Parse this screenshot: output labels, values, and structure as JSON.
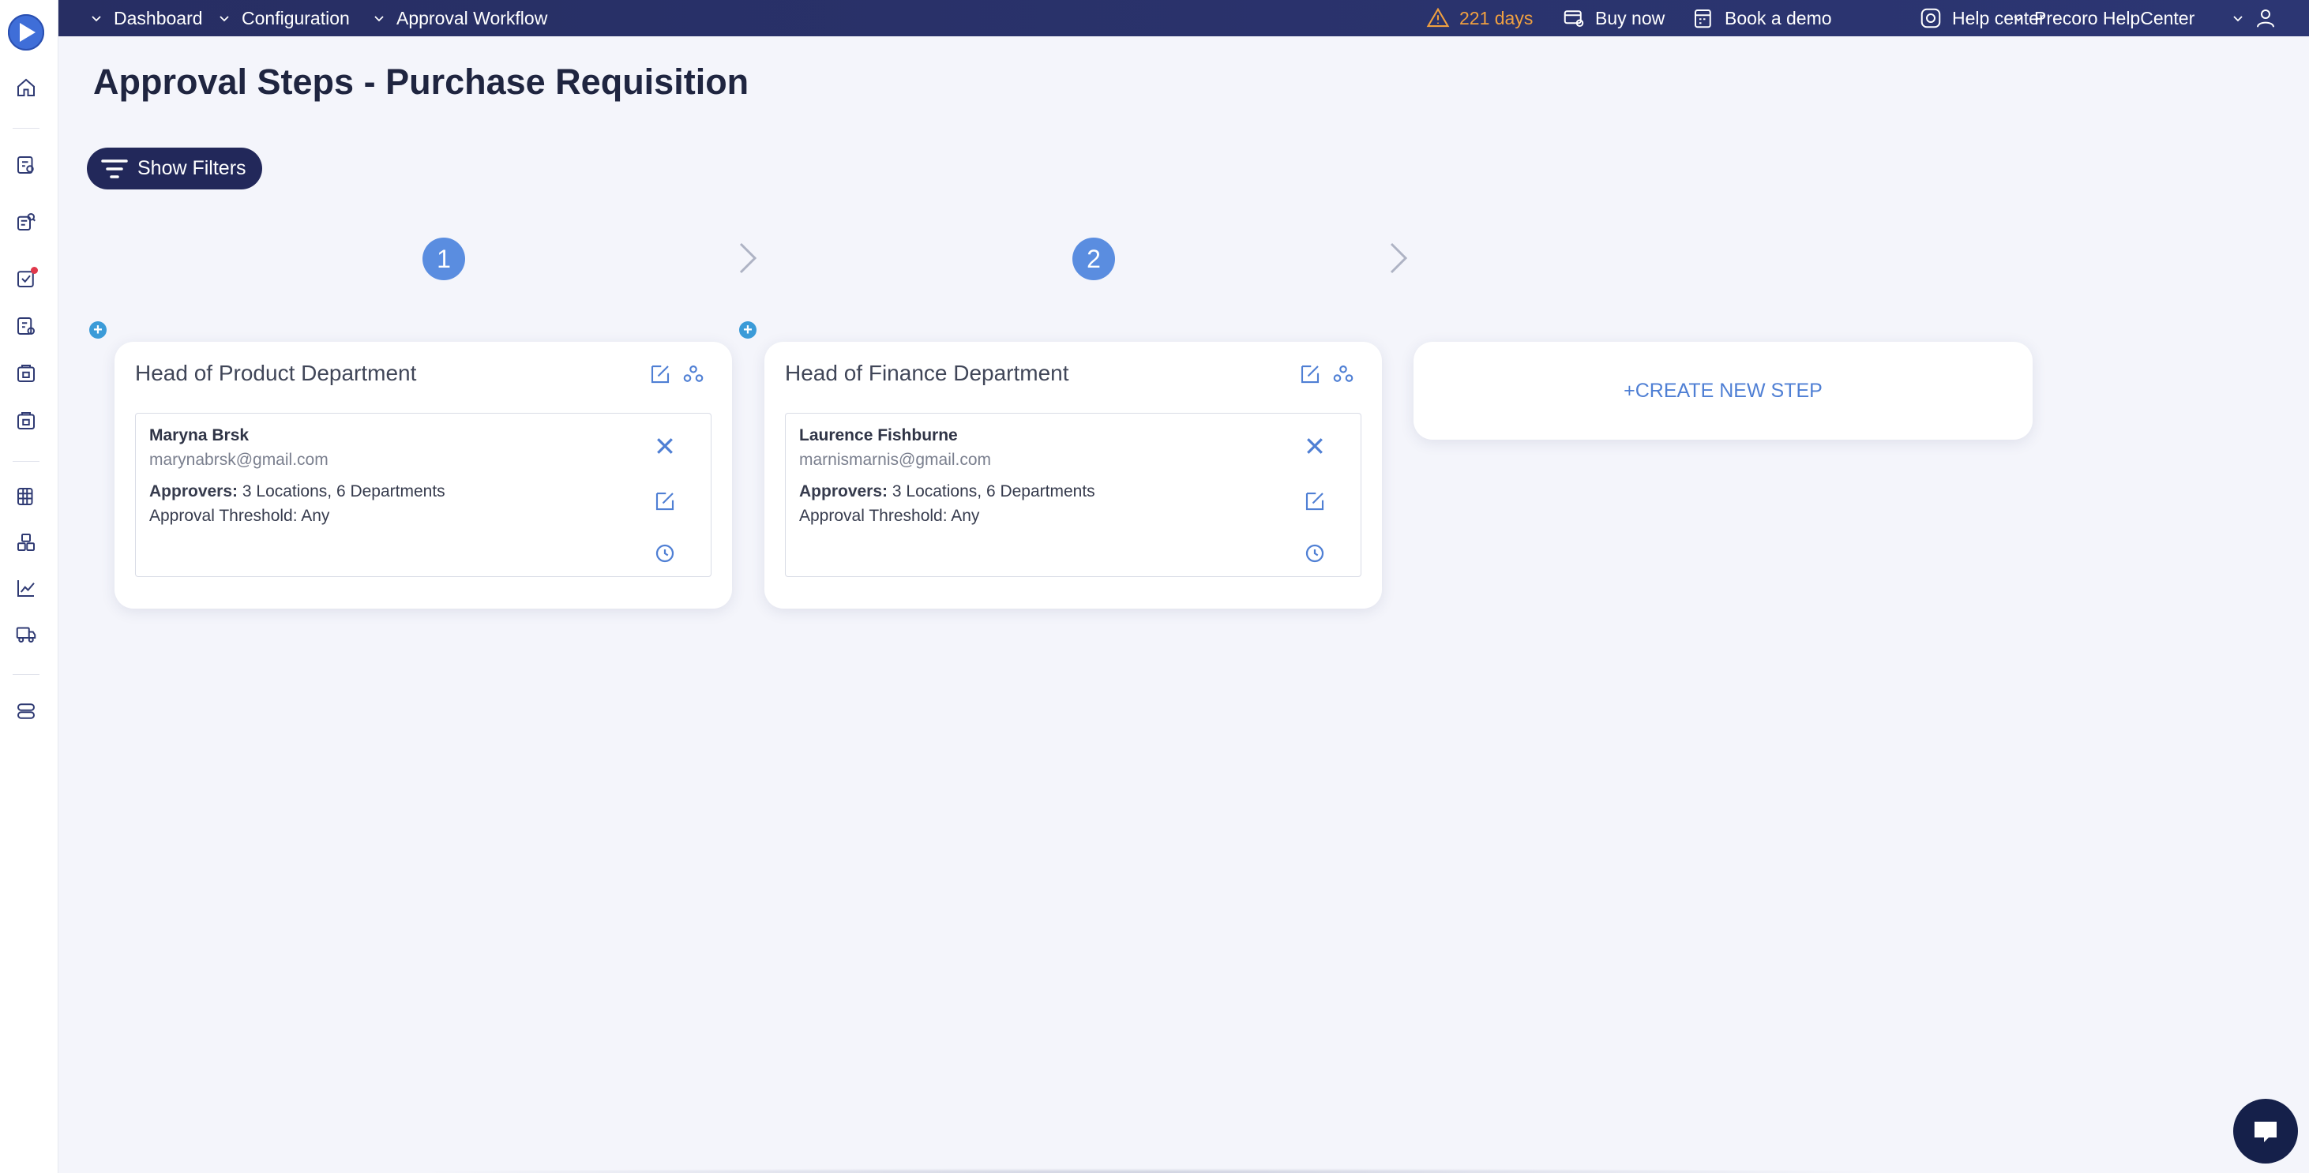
{
  "topbar": {
    "breadcrumbs": [
      {
        "label": "Dashboard"
      },
      {
        "label": "Configuration"
      },
      {
        "label": "Approval Workflow"
      }
    ],
    "trial_text": "221 days",
    "buy_now": "Buy now",
    "book_demo": "Book a demo",
    "help_center": "Help center",
    "account": "Precoro HelpCenter"
  },
  "page": {
    "title": "Approval Steps - Purchase Requisition",
    "filters_button": "Show Filters"
  },
  "steps": [
    {
      "number": "1",
      "title": "Head of Product Department",
      "approver": {
        "name": "Maryna Brsk",
        "email": "marynabrsk@gmail.com",
        "approvers_label": "Approvers:",
        "approvers_value": "3 Locations, 6 Departments",
        "threshold": "Approval Threshold: Any"
      }
    },
    {
      "number": "2",
      "title": "Head of Finance Department",
      "approver": {
        "name": "Laurence Fishburne",
        "email": "marnismarnis@gmail.com",
        "approvers_label": "Approvers:",
        "approvers_value": "3 Locations, 6 Departments",
        "threshold": "Approval Threshold: Any"
      }
    }
  ],
  "create_step_label": "+CREATE NEW STEP",
  "colors": {
    "topbar": "#272e63",
    "accent": "#5a8de0",
    "warning": "#f0a040",
    "icon_blue": "#4f7fd4",
    "sidebar_icon": "#2f3a73"
  },
  "icons": {
    "sidebar": [
      "home-icon",
      "requisition-icon",
      "supplier-icon",
      "approval-icon",
      "invoice-icon",
      "receipt-icon",
      "warehouse-icon",
      "budget-icon",
      "items-icon",
      "analytics-icon",
      "delivery-icon",
      "settings-icon"
    ],
    "topbar": [
      "warning-icon",
      "buy-icon",
      "calendar-icon",
      "lifebuoy-icon",
      "user-icon"
    ]
  }
}
